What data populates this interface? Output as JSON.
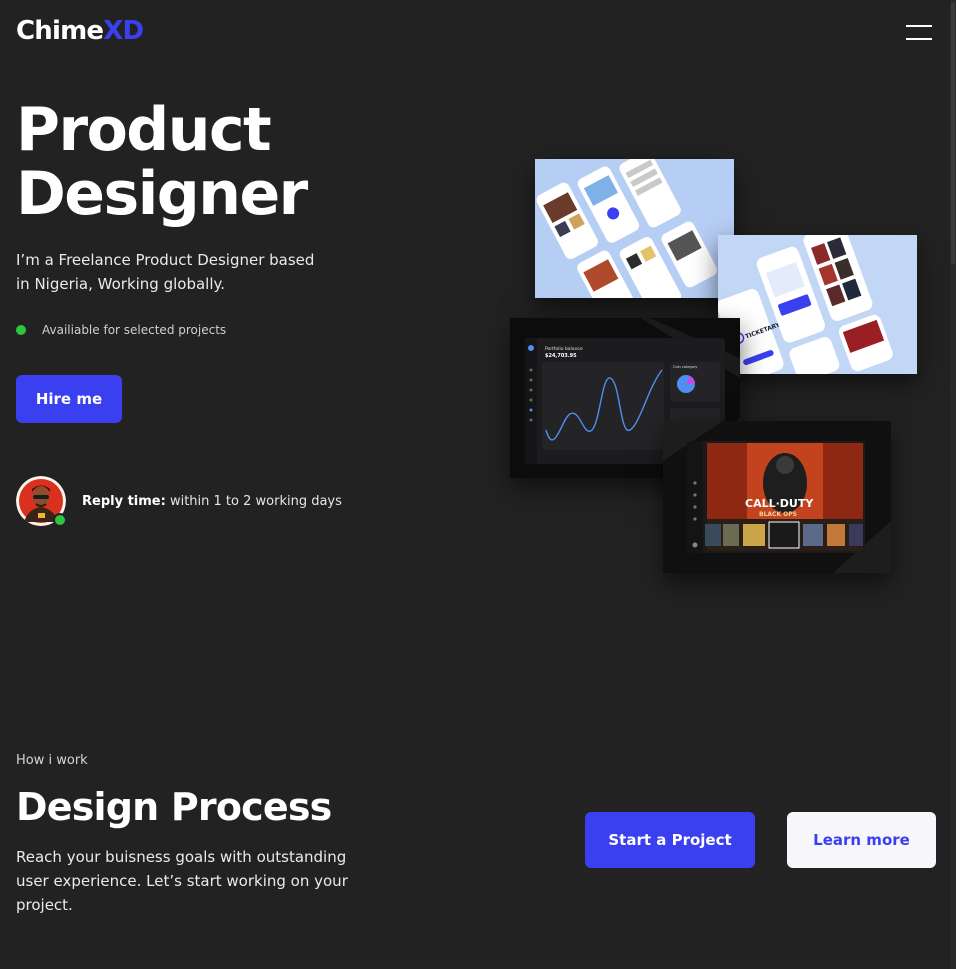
{
  "header": {
    "logo_primary": "Chime",
    "logo_accent": "XD",
    "menu_icon": "hamburger-menu-icon"
  },
  "hero": {
    "title_line1": "Product",
    "title_line2": "Designer",
    "description": "I’m a Freelance Product Designer based in Nigeria, Working globally.",
    "availability": "Availiable for selected projects",
    "hire_button": "Hire me",
    "reply_label": "Reply time:",
    "reply_value": " within 1 to 2 working days"
  },
  "mockups": {
    "wallet_title": "Portfolio balance",
    "wallet_amount": "$24,703.95",
    "chart_panel_title": "Coin category",
    "ticket_brand": "TICKETARY",
    "game_title_1": "CALL·DUTY",
    "game_title_2": "BLACK OPS"
  },
  "process": {
    "eyebrow": "How i work",
    "title": "Design Process",
    "description": "Reach your buisness goals with outstanding user experience. Let’s start working on your project.",
    "start_button": "Start a Project",
    "learn_button": "Learn more"
  },
  "colors": {
    "accent": "#3a40f0",
    "background": "#222222",
    "status": "#2ec63c"
  }
}
